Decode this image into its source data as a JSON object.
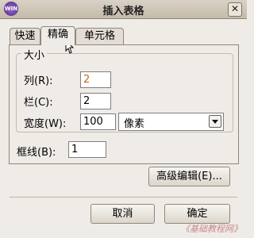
{
  "window": {
    "title": "插入表格",
    "close_symbol": "✕",
    "icon_text": "WIN"
  },
  "tabs": [
    {
      "label": "快速"
    },
    {
      "label": "精确"
    },
    {
      "label": "单元格"
    }
  ],
  "active_tab": "精确",
  "size_group": {
    "title": "大小",
    "columns": {
      "label": "列(R):",
      "value": "2"
    },
    "rows": {
      "label": "栏(C):",
      "value": "2"
    },
    "width": {
      "label": "宽度(W):",
      "value": "100"
    },
    "unit": {
      "value": "像素"
    }
  },
  "border": {
    "label": "框线(B):",
    "value": "1"
  },
  "buttons": {
    "advanced": "高级编辑(E)...",
    "cancel": "取消",
    "ok": "确定"
  },
  "watermark": "《基础教程网》"
}
